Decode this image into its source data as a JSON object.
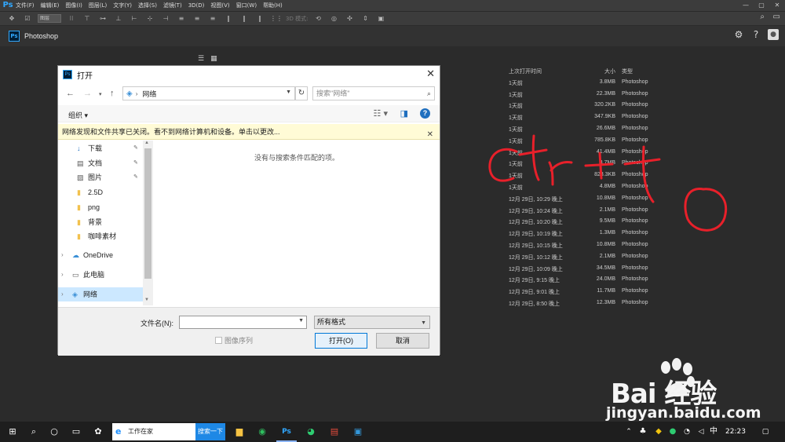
{
  "menubar": {
    "logo": "Ps",
    "items": [
      "文件(F)",
      "编辑(E)",
      "图像(I)",
      "图层(L)",
      "文字(Y)",
      "选择(S)",
      "滤镜(T)",
      "3D(D)",
      "视图(V)",
      "窗口(W)",
      "帮助(H)"
    ],
    "window_controls": [
      "—",
      "▢",
      "✕"
    ]
  },
  "options": {
    "layer_select": "图层",
    "mode_label": "3D 模式:"
  },
  "app": {
    "logo": "Ps",
    "title": "Photoshop"
  },
  "recent": {
    "headers": [
      "上次打开时间",
      "大小",
      "类型"
    ],
    "rows": [
      [
        "1天前",
        "3.8MB",
        "Photoshop"
      ],
      [
        "1天前",
        "22.3MB",
        "Photoshop"
      ],
      [
        "1天前",
        "320.2KB",
        "Photoshop"
      ],
      [
        "1天前",
        "347.9KB",
        "Photoshop"
      ],
      [
        "1天前",
        "26.6MB",
        "Photoshop"
      ],
      [
        "1天前",
        "785.8KB",
        "Photoshop"
      ],
      [
        "1天前",
        "41.4MB",
        "Photoshop"
      ],
      [
        "1天前",
        "3.7MB",
        "Photoshop"
      ],
      [
        "1天前",
        "823.3KB",
        "Photoshop"
      ],
      [
        "1天前",
        "4.8MB",
        "Photoshop"
      ],
      [
        "12月 29日, 10:29 晚上",
        "10.8MB",
        "Photoshop"
      ],
      [
        "12月 29日, 10:24 晚上",
        "2.1MB",
        "Photoshop"
      ],
      [
        "12月 29日, 10:20 晚上",
        "9.5MB",
        "Photoshop"
      ],
      [
        "12月 29日, 10:19 晚上",
        "1.3MB",
        "Photoshop"
      ],
      [
        "12月 29日, 10:15 晚上",
        "10.8MB",
        "Photoshop"
      ],
      [
        "12月 29日, 10:12 晚上",
        "2.1MB",
        "Photoshop"
      ],
      [
        "12月 29日, 10:09 晚上",
        "34.5MB",
        "Photoshop"
      ],
      [
        "12月 29日, 9:15 晚上",
        "24.0MB",
        "Photoshop"
      ],
      [
        "12月 29日, 9:01 晚上",
        "11.7MB",
        "Photoshop"
      ],
      [
        "12月 29日, 8:50 晚上",
        "12.3MB",
        "Photoshop"
      ]
    ]
  },
  "dialog": {
    "title": "打开",
    "address": "网络",
    "search_placeholder": "搜索\"网络\"",
    "organize": "组织 ▾",
    "infobar": "网络发现和文件共享已关闭。看不到网络计算机和设备。单击以更改...",
    "empty_message": "没有与搜索条件匹配的项。",
    "tree": [
      {
        "label": "下载",
        "icon": "↓",
        "pinned": true
      },
      {
        "label": "文档",
        "icon": "▤",
        "pinned": true
      },
      {
        "label": "图片",
        "icon": "▨",
        "pinned": true
      },
      {
        "label": "2.5D",
        "icon": "▮",
        "pinned": false
      },
      {
        "label": "png",
        "icon": "▮",
        "pinned": false
      },
      {
        "label": "背景",
        "icon": "▮",
        "pinned": false
      },
      {
        "label": "咖啡素材",
        "icon": "▮",
        "pinned": false
      }
    ],
    "tree_roots": [
      {
        "label": "OneDrive",
        "icon": "☁"
      },
      {
        "label": "此电脑",
        "icon": "▭"
      },
      {
        "label": "网络",
        "icon": "◈"
      }
    ],
    "filename_label": "文件名(N):",
    "filename_value": "",
    "format_value": "所有格式",
    "sequence_label": "图像序列",
    "open_button": "打开(O)",
    "cancel_button": "取消"
  },
  "watermark": {
    "brand": "Bai  经验",
    "url": "jingyan.baidu.com"
  },
  "taskbar": {
    "search_text": "工作在家",
    "search_button": "搜索一下",
    "ime": "中",
    "clock": "22:23"
  },
  "colors": {
    "ps_blue": "#31a8ff",
    "accent": "#0078d7",
    "scribble": "#e8202a"
  }
}
